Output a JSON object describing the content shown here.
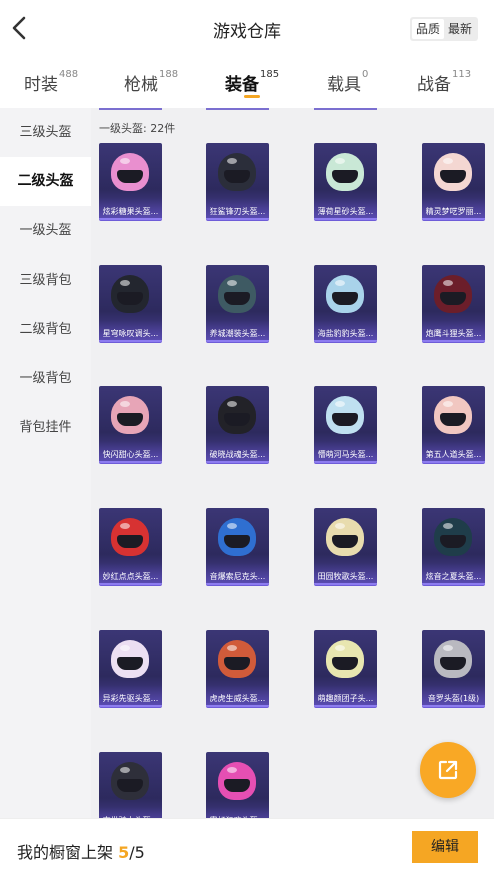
{
  "header": {
    "title": "游戏仓库",
    "toggle": [
      "品质",
      "最新"
    ]
  },
  "tabs": [
    {
      "label": "时装",
      "count": "488"
    },
    {
      "label": "枪械",
      "count": "188"
    },
    {
      "label": "装备",
      "count": "185"
    },
    {
      "label": "载具",
      "count": "0"
    },
    {
      "label": "战备",
      "count": "113"
    }
  ],
  "sidebar": {
    "items": [
      "三级头盔",
      "二级头盔",
      "一级头盔",
      "三级背包",
      "二级背包",
      "一级背包",
      "背包挂件"
    ]
  },
  "content": {
    "section_title": "一级头盔: 22件",
    "items": [
      {
        "name": "炫彩糖果头盔...",
        "color": "#e98fcf"
      },
      {
        "name": "狂鲨锋刃头盔...",
        "color": "#2b2e3a"
      },
      {
        "name": "薄荷星砂头盔...",
        "color": "#c9e8d6"
      },
      {
        "name": "精灵梦呓罗丽...",
        "color": "#f4d7d2"
      },
      {
        "name": "星穹咏叹调头...",
        "color": "#23262f"
      },
      {
        "name": "养城潮装头盔...",
        "color": "#3e5a63"
      },
      {
        "name": "海盐豹豹头盔...",
        "color": "#a9d3ea"
      },
      {
        "name": "炮鹰斗狸头盔...",
        "color": "#6c1e2a"
      },
      {
        "name": "快闪甜心头盔...",
        "color": "#e7a5b7"
      },
      {
        "name": "破晓战魂头盔...",
        "color": "#222228"
      },
      {
        "name": "懵萌河马头盔...",
        "color": "#bfe0f0"
      },
      {
        "name": "第五人道头盔...",
        "color": "#f1c7c1"
      },
      {
        "name": "妙红点点头盔...",
        "color": "#d73232"
      },
      {
        "name": "音爆索尼克头...",
        "color": "#2f6fd1"
      },
      {
        "name": "田园牧歌头盔...",
        "color": "#e8dcae"
      },
      {
        "name": "炫音之夏头盔...",
        "color": "#1f3d4a"
      },
      {
        "name": "异彩先驱头盔...",
        "color": "#ecdff2"
      },
      {
        "name": "虎虎生威头盔...",
        "color": "#d15b3a"
      },
      {
        "name": "萌趣颜团子头...",
        "color": "#e8e6b0"
      },
      {
        "name": "音罗头盔(1级)",
        "color": "#b9b9c0"
      },
      {
        "name": "末世骑士头盔...",
        "color": "#2e2f3a"
      },
      {
        "name": "霓虹狂欢头盔...",
        "color": "#e54fb3"
      }
    ]
  },
  "footer": {
    "label": "我的橱窗上架",
    "current": "5",
    "separator": "/",
    "total": "5",
    "edit_button": "编辑"
  },
  "colors": {
    "accent": "#f4a623",
    "card_bg": "#2d2a5e",
    "card_glow": "#8d7cf0"
  },
  "icons": [
    "back-arrow-icon",
    "share-external-icon"
  ]
}
